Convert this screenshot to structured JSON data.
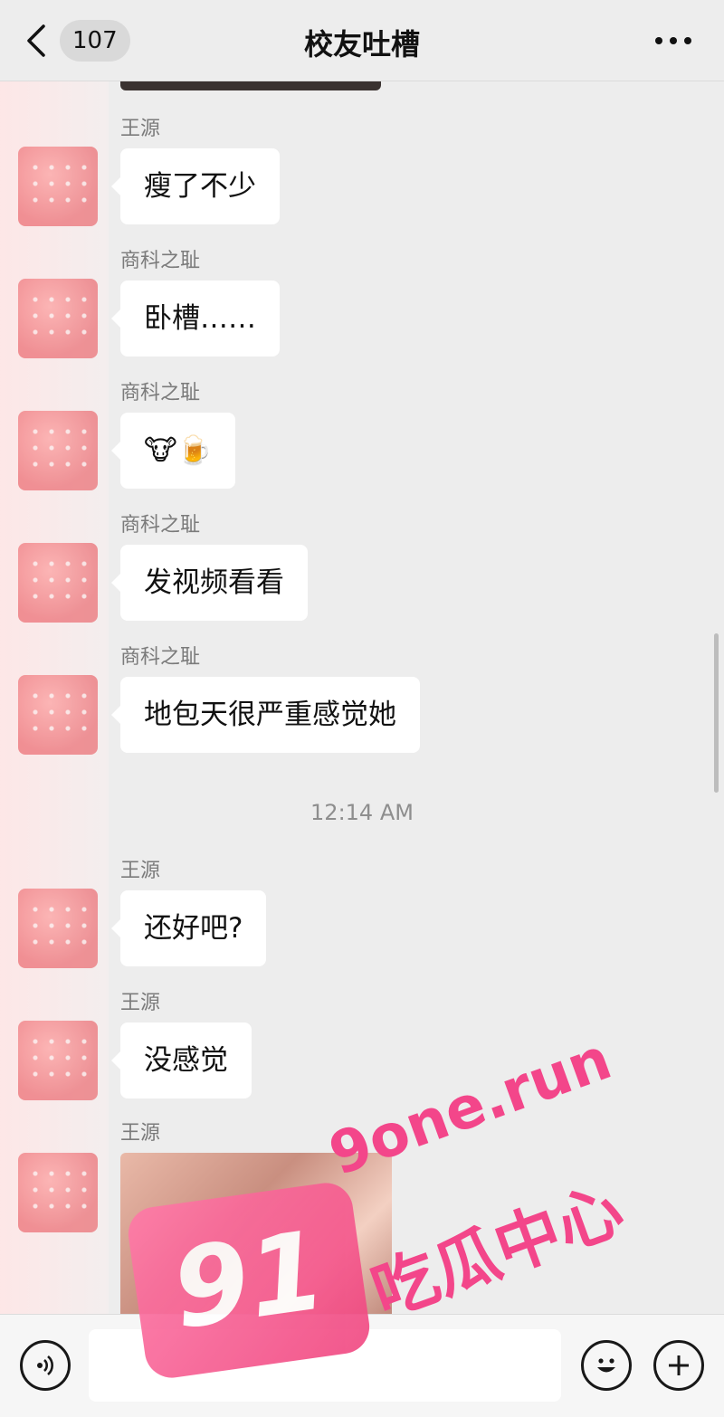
{
  "header": {
    "unread_count": "107",
    "title": "校友吐槽"
  },
  "messages": [
    {
      "sender": "王源",
      "text": "瘦了不少"
    },
    {
      "sender": "商科之耻",
      "text": "卧槽……"
    },
    {
      "sender": "商科之耻",
      "text": "🐮🍺"
    },
    {
      "sender": "商科之耻",
      "text": "发视频看看"
    },
    {
      "sender": "商科之耻",
      "text": "地包天很严重感觉她"
    }
  ],
  "timestamp": "12:14 AM",
  "messages_after": [
    {
      "sender": "王源",
      "text": "还好吧?"
    },
    {
      "sender": "王源",
      "text": "没感觉"
    },
    {
      "sender": "王源",
      "text": ""
    }
  ],
  "watermark": {
    "number": "91",
    "domain": "9one.run",
    "label": "吃瓜中心"
  },
  "icons": {
    "back": "chevron-left-icon",
    "more": "more-dots-icon",
    "voice": "voice-icon",
    "emoji": "emoji-icon",
    "add": "plus-icon"
  },
  "colors": {
    "background": "#ededed",
    "bubble": "#ffffff",
    "watermark_pink": "#f3468a"
  }
}
